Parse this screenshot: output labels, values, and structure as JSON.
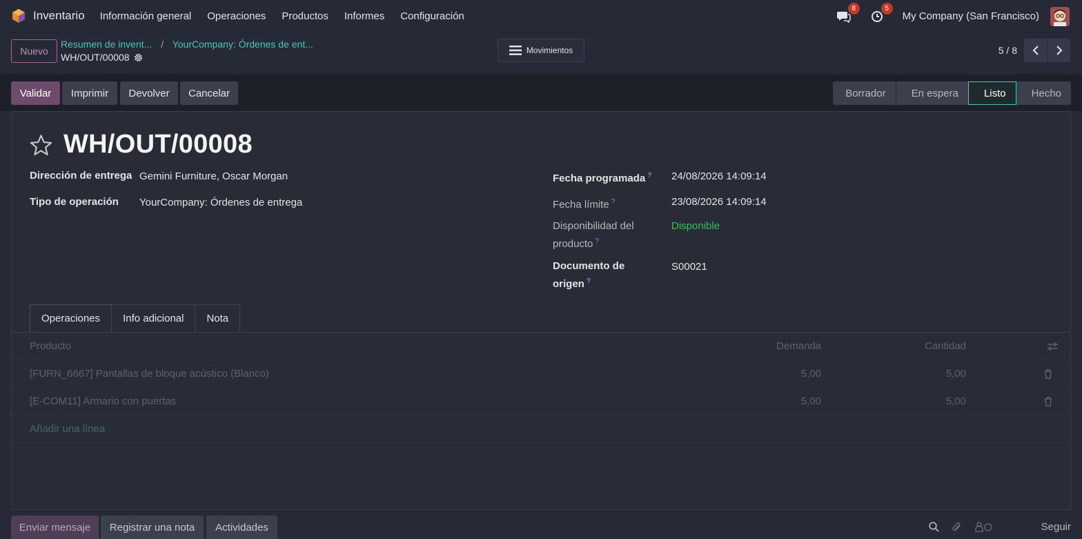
{
  "navbar": {
    "app_name": "Inventario",
    "menu": [
      "Información general",
      "Operaciones",
      "Productos",
      "Informes",
      "Configuración"
    ],
    "messages_count": "8",
    "activities_count": "5",
    "company": "My Company (San Francisco)"
  },
  "control_panel": {
    "new_label": "Nuevo",
    "breadcrumb": [
      "Resumen de invent...",
      "YourCompany: Órdenes de ent..."
    ],
    "record_name": "WH/OUT/00008",
    "movements_label": "Movimientos",
    "pager": "5 / 8"
  },
  "actions": {
    "validate": "Validar",
    "print": "Imprimir",
    "return": "Devolver",
    "cancel": "Cancelar"
  },
  "status_stages": [
    "Borrador",
    "En espera",
    "Listo",
    "Hecho"
  ],
  "status_active": "Listo",
  "record": {
    "title": "WH/OUT/00008",
    "delivery_address_label": "Dirección de entrega",
    "delivery_address": "Gemini Furniture, Oscar Morgan",
    "operation_type_label": "Tipo de operación",
    "operation_type": "YourCompany: Órdenes de entrega",
    "scheduled_date_label": "Fecha programada",
    "scheduled_date": "24/08/2026 14:09:14",
    "deadline_label": "Fecha límite",
    "deadline": "23/08/2026 14:09:14",
    "availability_label_1": "Disponibilidad del",
    "availability_label_2": "producto",
    "availability": "Disponible",
    "source_doc_label_1": "Documento de",
    "source_doc_label_2": "origen",
    "source_doc": "S00021",
    "help_mark": "?"
  },
  "tabs": [
    "Operaciones",
    "Info adicional",
    "Nota"
  ],
  "table": {
    "headers": {
      "product": "Producto",
      "demand": "Demanda",
      "quantity": "Cantidad"
    },
    "rows": [
      {
        "product": "[FURN_6667] Pantallas de bloque acústico (Blanco)",
        "demand": "5,00",
        "quantity": "5,00"
      },
      {
        "product": "[E-COM11] Armario con puertas",
        "demand": "5,00",
        "quantity": "5,00"
      }
    ],
    "add_line": "Añadir una línea"
  },
  "chatter": {
    "send_message": "Enviar mensaje",
    "log_note": "Registrar una nota",
    "activities": "Actividades",
    "follow": "Seguir"
  },
  "colors": {
    "accent": "#6f4b6b",
    "link": "#4fc3b4",
    "available": "#3cbf5a",
    "badge": "#c0392b"
  },
  "icons": [
    "odoo-logo-icon",
    "chat-icon",
    "clock-icon",
    "gear-icon",
    "hamburger-icon",
    "chevron-left-icon",
    "chevron-right-icon",
    "star-icon",
    "settings-sliders-icon",
    "trash-icon",
    "search-icon",
    "paperclip-icon",
    "followers-icon"
  ]
}
